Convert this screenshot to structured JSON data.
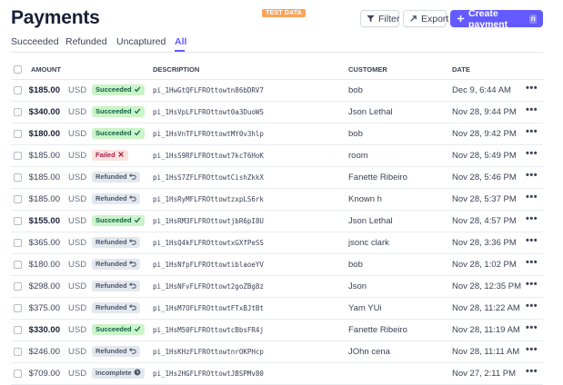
{
  "header": {
    "title": "Payments",
    "test_badge": "TEST DATA",
    "filter_label": "Filter",
    "export_label": "Export",
    "create_label": "Create payment",
    "create_shortcut": "n"
  },
  "tabs": [
    "Succeeded",
    "Refunded",
    "Uncaptured",
    "All"
  ],
  "active_tab": "All",
  "columns": {
    "amount": "AMOUNT",
    "description": "DESCRIPTION",
    "customer": "CUSTOMER",
    "date": "DATE"
  },
  "rows": [
    {
      "amount": "$185.00",
      "currency": "USD",
      "status": "Succeeded",
      "status_icon": "check-icon",
      "description": "pi_1HwGtQFLFROttowtn86bDRV7",
      "customer": "bob",
      "date": "Dec 9, 6:44 AM"
    },
    {
      "amount": "$340.00",
      "currency": "USD",
      "status": "Succeeded",
      "status_icon": "check-icon",
      "description": "pi_1HsVpLFLFROttowt0a3DuoWS",
      "customer": "Json Lethal",
      "date": "Nov 28, 9:44 PM"
    },
    {
      "amount": "$180.00",
      "currency": "USD",
      "status": "Succeeded",
      "status_icon": "check-icon",
      "description": "pi_1HsVnTFLFROttowtMY0v3hlp",
      "customer": "bob",
      "date": "Nov 28, 9:42 PM"
    },
    {
      "amount": "$185.00",
      "currency": "USD",
      "status": "Failed",
      "status_icon": "x-icon",
      "description": "pi_1HsS9RFLFROttowt7kcT6HoK",
      "customer": "room",
      "date": "Nov 28, 5:49 PM"
    },
    {
      "amount": "$185.00",
      "currency": "USD",
      "status": "Refunded",
      "status_icon": "refund-icon",
      "description": "pi_1HsS7ZFLFROttowtCishZkkX",
      "customer": "Fanette Ribeiro",
      "date": "Nov 28, 5:46 PM"
    },
    {
      "amount": "$185.00",
      "currency": "USD",
      "status": "Refunded",
      "status_icon": "refund-icon",
      "description": "pi_1HsRyMFLFROttowtzxpLS6rk",
      "customer": "Known h",
      "date": "Nov 28, 5:37 PM"
    },
    {
      "amount": "$155.00",
      "currency": "USD",
      "status": "Succeeded",
      "status_icon": "check-icon",
      "description": "pi_1HsRM3FLFROttowtjbR6pI8U",
      "customer": "Json Lethal",
      "date": "Nov 28, 4:57 PM"
    },
    {
      "amount": "$365.00",
      "currency": "USD",
      "status": "Refunded",
      "status_icon": "refund-icon",
      "description": "pi_1HsQ4kFLFROttowtxGXfPeSS",
      "customer": "jsonc clark",
      "date": "Nov 28, 3:36 PM"
    },
    {
      "amount": "$180.00",
      "currency": "USD",
      "status": "Refunded",
      "status_icon": "refund-icon",
      "description": "pi_1HsNfpFLFROttowtiblaoeYV",
      "customer": "bob",
      "date": "Nov 28, 1:02 PM"
    },
    {
      "amount": "$298.00",
      "currency": "USD",
      "status": "Refunded",
      "status_icon": "refund-icon",
      "description": "pi_1HsNFvFLFROttowt2goZBg8z",
      "customer": "Json",
      "date": "Nov 28, 12:35 PM"
    },
    {
      "amount": "$375.00",
      "currency": "USD",
      "status": "Refunded",
      "status_icon": "refund-icon",
      "description": "pi_1HsM7OFLFROttowtFTxBJtBt",
      "customer": "Yam YUi",
      "date": "Nov 28, 11:22 AM"
    },
    {
      "amount": "$330.00",
      "currency": "USD",
      "status": "Succeeded",
      "status_icon": "check-icon",
      "description": "pi_1HsM50FLFROttowtcBbsFR4j",
      "customer": "Fanette Ribeiro",
      "date": "Nov 28, 11:19 AM"
    },
    {
      "amount": "$246.00",
      "currency": "USD",
      "status": "Refunded",
      "status_icon": "refund-icon",
      "description": "pi_1HsKHzFLFROttowtnrOKPHcp",
      "customer": "JOhn cena",
      "date": "Nov 28, 11:11 AM"
    },
    {
      "amount": "$709.00",
      "currency": "USD",
      "status": "Incomplete",
      "status_icon": "clock-icon",
      "description": "pi_1Hs2HGFLFROttowtJBSPMv80",
      "customer": "",
      "date": "Nov 27, 2:11 PM"
    }
  ],
  "row_action": "•••",
  "colors": {
    "accent": "#635bff",
    "test_badge": "#f7a35c",
    "succeeded_bg": "#cbf4c9",
    "failed_bg": "#fde2dd",
    "neutral_bg": "#e3e8ee"
  }
}
